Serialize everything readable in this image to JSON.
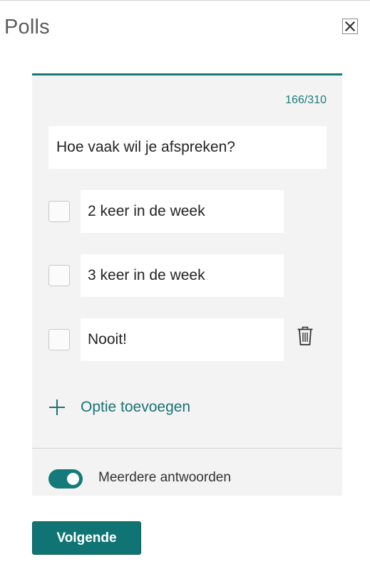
{
  "header": {
    "title": "Polls",
    "close_icon": "close-icon"
  },
  "poll": {
    "counter": "166/310",
    "question": "Hoe vaak wil je afspreken?",
    "options": [
      {
        "label": "2 keer in de week",
        "checked": false
      },
      {
        "label": "3 keer in de week",
        "checked": false
      },
      {
        "label": "Nooit!",
        "checked": false,
        "delete_icon": "trash-icon"
      }
    ],
    "add_option_label": "Optie toevoegen",
    "add_option_icon": "plus-icon",
    "multiple_answers": {
      "label": "Meerdere antwoorden",
      "enabled": true
    }
  },
  "footer": {
    "next_label": "Volgende"
  },
  "colors": {
    "accent": "#147a7a",
    "panel_bg": "#f3f3f3",
    "button_bg": "#117474"
  }
}
